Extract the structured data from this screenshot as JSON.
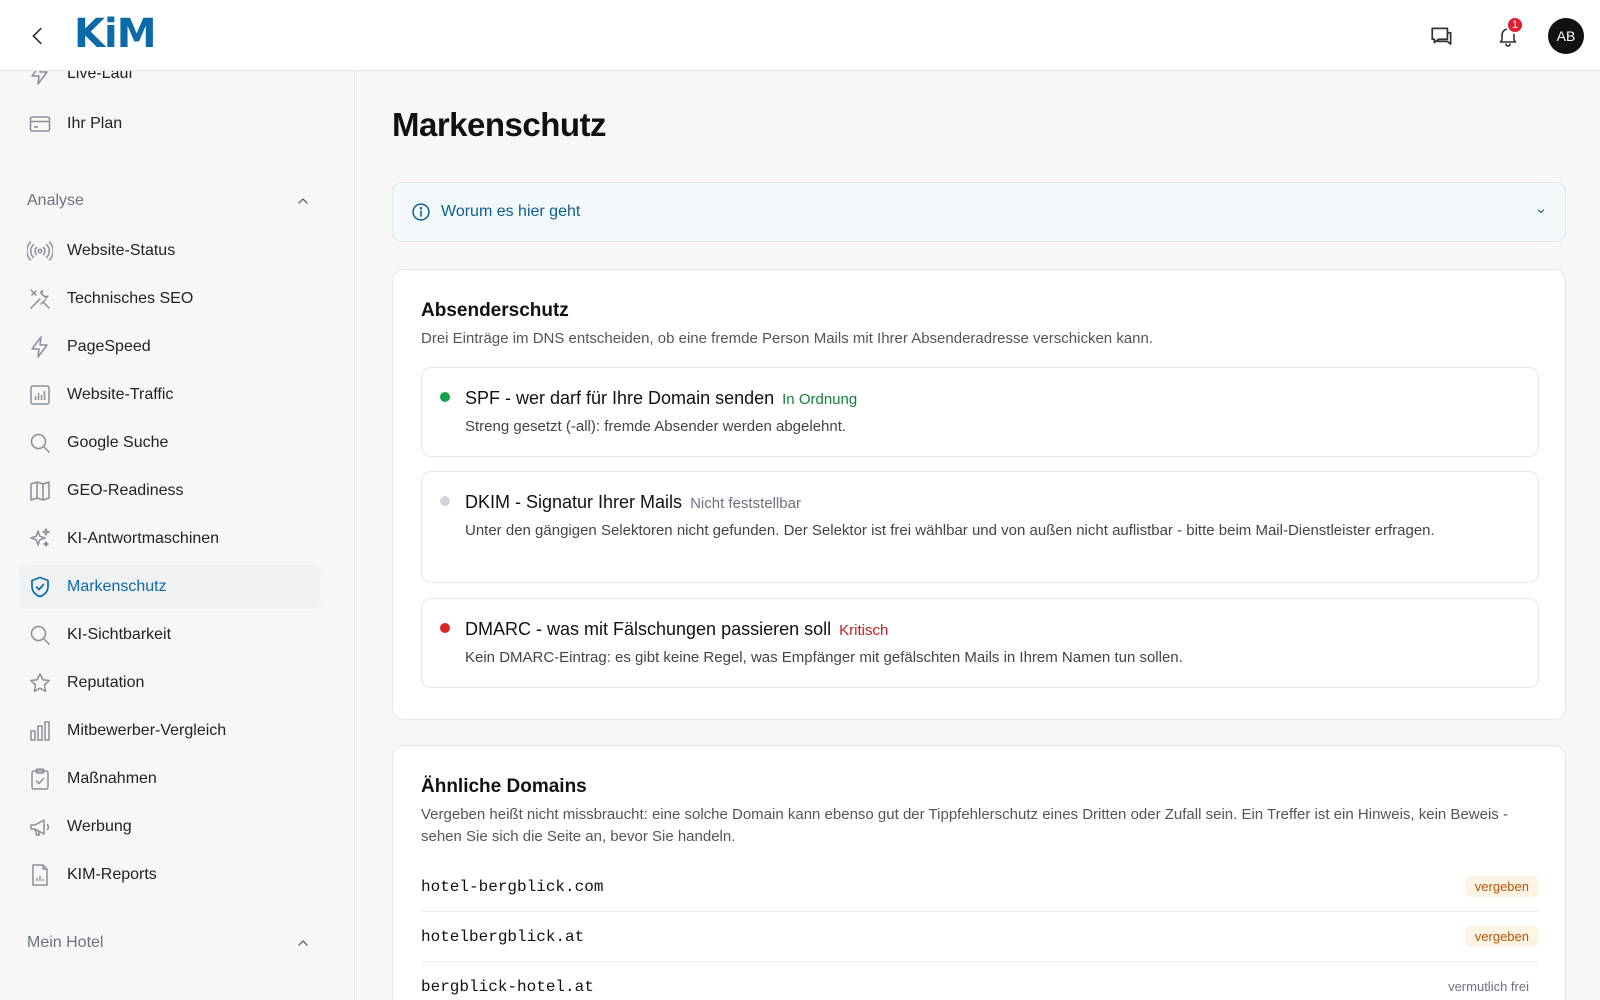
{
  "header": {
    "logo_text": "KiM",
    "notification_count": "1",
    "avatar_initials": "AB"
  },
  "sidebar": {
    "top_items": [
      {
        "label": "Live-Lauf",
        "icon": "bolt-icon"
      },
      {
        "label": "Ihr Plan",
        "icon": "credit-card-icon"
      }
    ],
    "section_analyse": "Analyse",
    "analyse_items": [
      {
        "label": "Website-Status",
        "icon": "broadcast-icon"
      },
      {
        "label": "Technisches SEO",
        "icon": "tools-icon"
      },
      {
        "label": "PageSpeed",
        "icon": "bolt-icon"
      },
      {
        "label": "Website-Traffic",
        "icon": "bar-chart-icon"
      },
      {
        "label": "Google Suche",
        "icon": "search-icon"
      },
      {
        "label": "GEO-Readiness",
        "icon": "map-icon"
      },
      {
        "label": "KI-Antwortmaschinen",
        "icon": "sparkles-icon"
      },
      {
        "label": "Markenschutz",
        "icon": "shield-check-icon",
        "active": true
      },
      {
        "label": "KI-Sichtbarkeit",
        "icon": "search-icon"
      },
      {
        "label": "Reputation",
        "icon": "star-icon"
      },
      {
        "label": "Mitbewerber-Vergleich",
        "icon": "columns-chart-icon"
      },
      {
        "label": "Maßnahmen",
        "icon": "clipboard-check-icon"
      },
      {
        "label": "Werbung",
        "icon": "megaphone-icon"
      },
      {
        "label": "KIM-Reports",
        "icon": "report-icon"
      }
    ],
    "section_hotel": "Mein Hotel"
  },
  "main": {
    "title": "Markenschutz",
    "info_label": "Worum es hier geht",
    "sender": {
      "title": "Absenderschutz",
      "subtitle": "Drei Einträge im DNS entscheiden, ob eine fremde Person Mails mit Ihrer Absenderadresse verschicken kann.",
      "checks": [
        {
          "title": "SPF - wer darf für Ihre Domain senden",
          "status": "In Ordnung",
          "status_color": "#15803d",
          "dot_color": "#16a34a",
          "desc": "Streng gesetzt (-all): fremde Absender werden abgelehnt."
        },
        {
          "title": "DKIM - Signatur Ihrer Mails",
          "status": "Nicht feststellbar",
          "status_color": "#6b7280",
          "dot_color": "#d1d5db",
          "desc": "Unter den gängigen Selektoren nicht gefunden. Der Selektor ist frei wählbar und von außen nicht auflistbar - bitte beim Mail-Dienstleister erfragen."
        },
        {
          "title": "DMARC - was mit Fälschungen passieren soll",
          "status": "Kritisch",
          "status_color": "#c81e1e",
          "dot_color": "#dc2626",
          "desc": "Kein DMARC-Eintrag: es gibt keine Regel, was Empfänger mit gefälschten Mails in Ihrem Namen tun sollen."
        }
      ]
    },
    "similar": {
      "title": "Ähnliche Domains",
      "subtitle": "Vergeben heißt nicht missbraucht: eine solche Domain kann ebenso gut der Tippfehlerschutz eines Dritten oder Zufall sein. Ein Treffer ist ein Hinweis, kein Beweis - sehen Sie sich die Seite an, bevor Sie handeln.",
      "domains": [
        {
          "name": "hotel-bergblick.com",
          "tag": "vergeben"
        },
        {
          "name": "hotelbergblick.at",
          "tag": "vergeben"
        },
        {
          "name": "bergblick-hotel.at",
          "tag": "vermutlich frei"
        }
      ]
    }
  }
}
